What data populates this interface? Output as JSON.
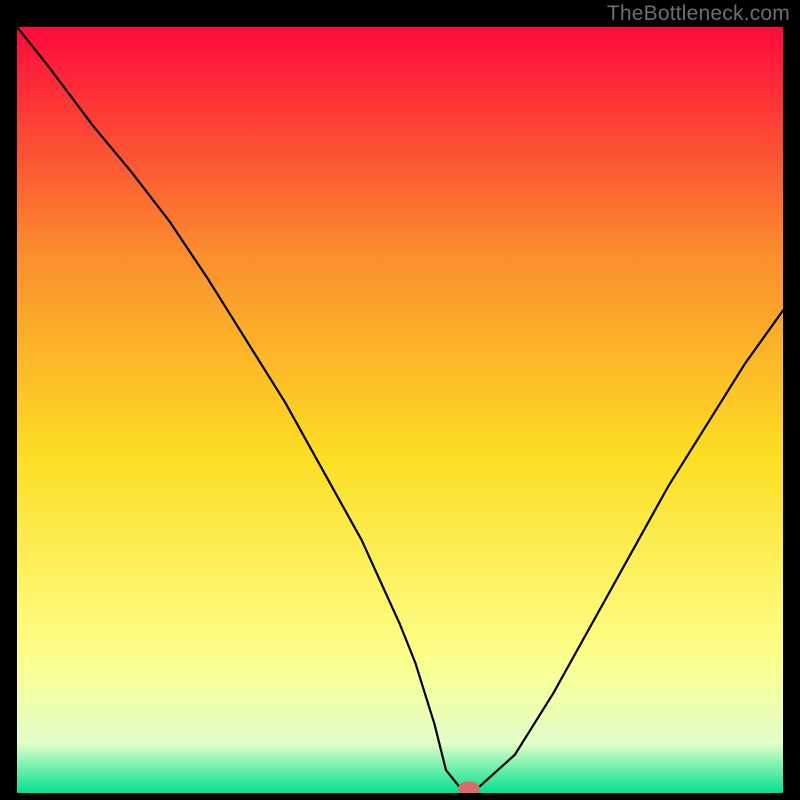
{
  "watermark": "TheBottleneck.com",
  "colors": {
    "gradient_top": "#fe093c",
    "gradient_mid_upper": "#fb8f2d",
    "gradient_mid": "#fcde23",
    "gradient_lower": "#feff8a",
    "gradient_near_bottom": "#e2ffc9",
    "gradient_bottom": "#02e090",
    "curve_stroke": "#000000",
    "marker_fill": "#d86d67",
    "background": "#000000"
  },
  "chart_data": {
    "type": "line",
    "title": "",
    "xlabel": "",
    "ylabel": "",
    "xlim": [
      0,
      100
    ],
    "ylim": [
      0,
      100
    ],
    "series": [
      {
        "name": "bottleneck-curve",
        "x": [
          0,
          4,
          10,
          15,
          20,
          25,
          30,
          35,
          40,
          45,
          50,
          52,
          54.5,
          56,
          58,
          60,
          65,
          70,
          75,
          80,
          85,
          90,
          95,
          100
        ],
        "values": [
          100,
          95,
          87,
          81,
          74.5,
          67,
          59,
          51,
          42,
          33,
          22,
          17,
          9,
          3,
          0.5,
          0.5,
          5,
          13,
          22,
          31,
          40,
          48,
          56,
          63
        ]
      }
    ],
    "marker": {
      "x": 59,
      "y": 0.6,
      "shape": "ellipse"
    },
    "annotations": []
  }
}
